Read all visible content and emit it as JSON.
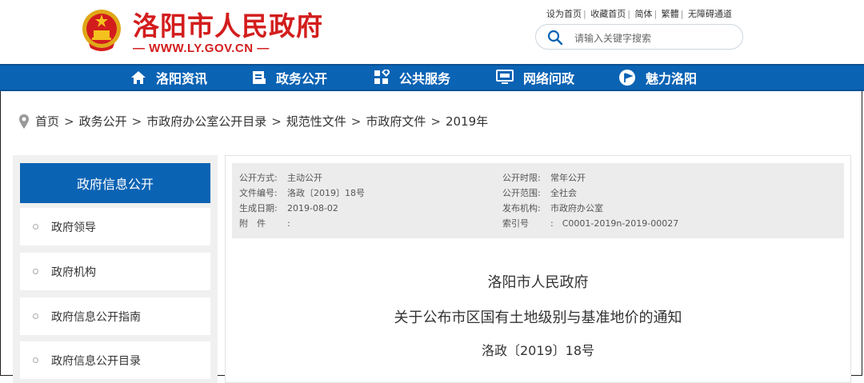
{
  "header": {
    "site_name": "洛阳市人民政府",
    "site_url": "— WWW.LY.GOV.CN —",
    "top_links": [
      "设为首页",
      "收藏首页",
      "简体",
      "繁體",
      "无障碍通道"
    ],
    "search_placeholder": "请输入关键字搜索"
  },
  "nav": {
    "items": [
      {
        "label": "洛阳资讯",
        "icon": "home-icon"
      },
      {
        "label": "政务公开",
        "icon": "document-icon"
      },
      {
        "label": "公共服务",
        "icon": "grid-icon"
      },
      {
        "label": "网络问政",
        "icon": "monitor-icon"
      },
      {
        "label": "魅力洛阳",
        "icon": "flag-icon"
      }
    ]
  },
  "breadcrumb": [
    "首页",
    "政务公开",
    "市政府办公室公开目录",
    "规范性文件",
    "市政府文件",
    "2019年"
  ],
  "sidebar": {
    "title": "政府信息公开",
    "items": [
      "政府领导",
      "政府机构",
      "政府信息公开指南",
      "政府信息公开目录"
    ]
  },
  "meta": {
    "left": [
      {
        "k": "公开方式:",
        "v": "主动公开"
      },
      {
        "k": "文件编号:",
        "v": "洛政〔2019〕18号"
      },
      {
        "k": "生成日期:",
        "v": "2019-08-02"
      },
      {
        "k": "附　件",
        "v": ":"
      }
    ],
    "right": [
      {
        "k": "公开时限:",
        "v": "常年公开"
      },
      {
        "k": "公开范围:",
        "v": "全社会"
      },
      {
        "k": "发布机构:",
        "v": "市政府办公室"
      },
      {
        "k": "索引号",
        "v": ":　C0001-2019n-2019-00027"
      }
    ]
  },
  "document": {
    "issuer": "洛阳市人民政府",
    "title": "关于公布市区国有土地级别与基准地价的通知",
    "number": "洛政〔2019〕18号"
  },
  "colors": {
    "brand_red": "#d31d1d",
    "nav_blue": "#0b63b4"
  }
}
